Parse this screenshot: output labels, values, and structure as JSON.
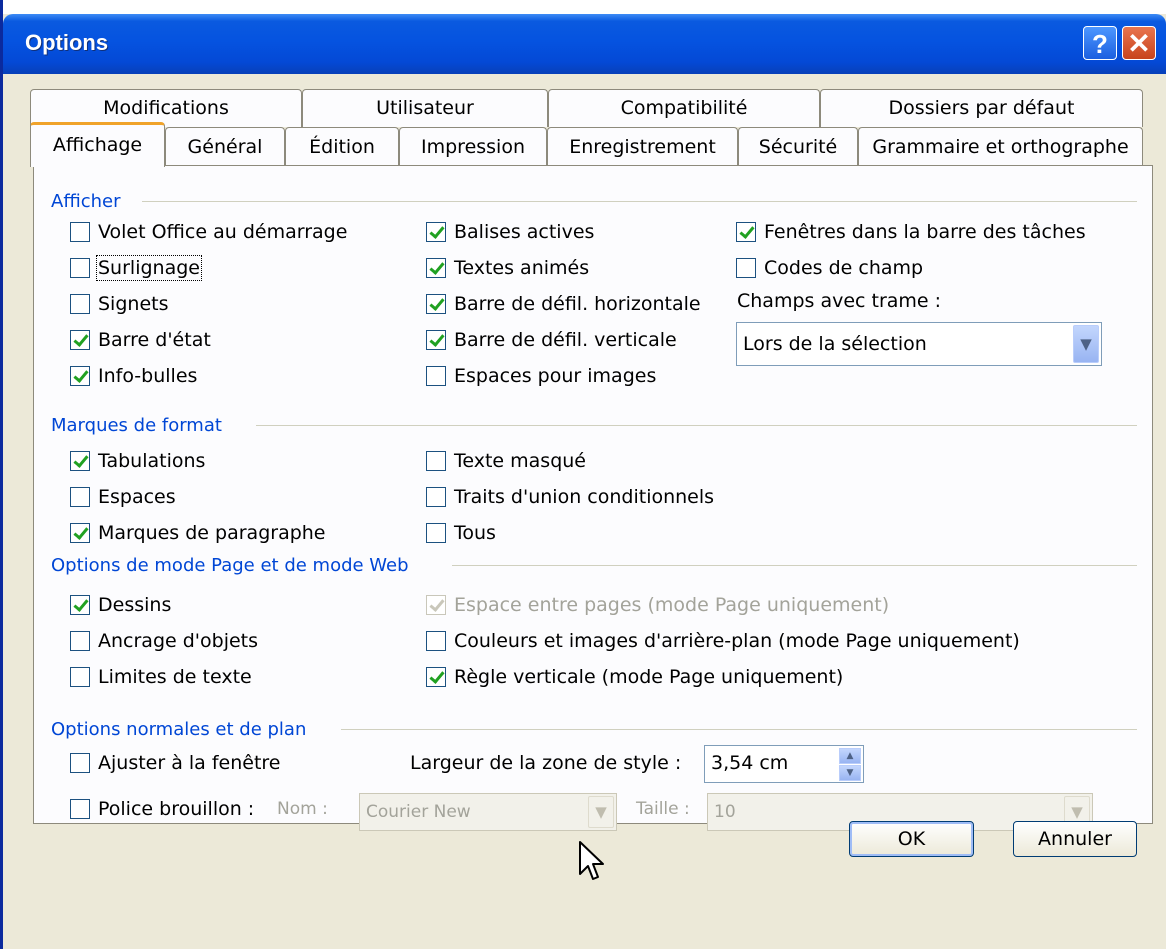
{
  "window": {
    "title": "Options"
  },
  "titlebar": {
    "help": "?",
    "close": "✕"
  },
  "tabs": {
    "row1": [
      "Modifications",
      "Utilisateur",
      "Compatibilité",
      "Dossiers par défaut"
    ],
    "row2": [
      "Affichage",
      "Général",
      "Édition",
      "Impression",
      "Enregistrement",
      "Sécurité",
      "Grammaire et orthographe"
    ],
    "active": "Affichage"
  },
  "afficher": {
    "title": "Afficher",
    "col1": [
      {
        "label": "Volet Office au démarrage",
        "checked": false
      },
      {
        "label": "Surlignage",
        "checked": false
      },
      {
        "label": "Signets",
        "checked": false
      },
      {
        "label": "Barre d'état",
        "checked": true
      },
      {
        "label": "Info-bulles",
        "checked": true
      }
    ],
    "col2": [
      {
        "label": "Balises actives",
        "checked": true
      },
      {
        "label": "Textes animés",
        "checked": true
      },
      {
        "label": "Barre de défil. horizontale",
        "checked": true
      },
      {
        "label": "Barre de défil. verticale",
        "checked": true
      },
      {
        "label": "Espaces pour images",
        "checked": false
      }
    ],
    "col3": [
      {
        "label": "Fenêtres dans la barre des tâches",
        "checked": true
      },
      {
        "label": "Codes de champ",
        "checked": false
      }
    ],
    "field_shading_label": "Champs avec trame :",
    "field_shading_value": "Lors de la sélection"
  },
  "marques": {
    "title": "Marques de format",
    "col1": [
      {
        "label": "Tabulations",
        "checked": true
      },
      {
        "label": "Espaces",
        "checked": false
      },
      {
        "label": "Marques de paragraphe",
        "checked": true
      }
    ],
    "col2": [
      {
        "label": "Texte masqué",
        "checked": false
      },
      {
        "label": "Traits d'union conditionnels",
        "checked": false
      },
      {
        "label": "Tous",
        "checked": false
      }
    ]
  },
  "mode_page": {
    "title": "Options de mode Page et de mode Web",
    "col1": [
      {
        "label": "Dessins",
        "checked": true
      },
      {
        "label": "Ancrage d'objets",
        "checked": false
      },
      {
        "label": "Limites de texte",
        "checked": false
      }
    ],
    "col2": [
      {
        "label": "Espace entre pages (mode Page uniquement)",
        "checked": true,
        "disabled": true
      },
      {
        "label": "Couleurs et images d'arrière-plan (mode Page uniquement)",
        "checked": false
      },
      {
        "label": "Règle verticale (mode Page uniquement)",
        "checked": true
      }
    ]
  },
  "normal": {
    "title": "Options normales et de plan",
    "fit_window": {
      "label": "Ajuster à la fenêtre",
      "checked": false
    },
    "style_width_label": "Largeur de la zone de style :",
    "style_width_value": "3,54 cm",
    "draft_font": {
      "label": "Police brouillon :",
      "checked": false
    },
    "name_label": "Nom :",
    "name_value": "Courier New",
    "size_label": "Taille :",
    "size_value": "10"
  },
  "buttons": {
    "ok": "OK",
    "cancel": "Annuler"
  },
  "icons": {
    "dropdown": "chevron-down-icon",
    "spin": "spin-icon",
    "pointer": "mouse-pointer-icon"
  }
}
